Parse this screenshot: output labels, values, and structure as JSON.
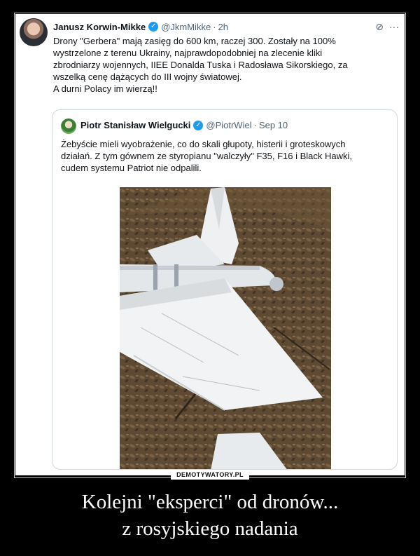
{
  "post": {
    "author": "Janusz Korwin-Mikke",
    "handle": "@JkmMikke",
    "time": "2h",
    "separator": "·",
    "lines": [
      "Drony \"Gerbera\" mają zasięg do 600 km, raczej 300. Zostały na 100%",
      "wystrzelone z terenu Ukrainy, najprawdopodobniej na zlecenie kliki",
      "zbrodniarzy wojennych, IIEE Donalda Tuska i Radosława Sikorskiego, za",
      "wszelką cenę dążących do III wojny światowej.",
      "A durni Polacy im wierzą!!"
    ],
    "icons": {
      "grok": "slash-circle-icon",
      "more": "more-icon"
    }
  },
  "quote": {
    "author": "Piotr Stanisław Wielgucki",
    "handle": "@PiotrWiel",
    "time": "Sep 10",
    "separator": "·",
    "lines": [
      "Żebyście mieli wyobrażenie, co do skali głupoty, histerii i groteskowych",
      "działań. Z tym gównem ze styropianu \"walczyły\" F35, F16 i Black Hawki,",
      "cudem systemu Patriot nie odpalili."
    ]
  },
  "watermark": "DEMOTYWATORY.PL",
  "caption": {
    "line1": "Kolejni \"eksperci\" od dronów...",
    "line2": "z rosyjskiego nadania"
  },
  "colors": {
    "verified": "#1d9bf0",
    "text": "#0f1419",
    "muted": "#536471"
  }
}
